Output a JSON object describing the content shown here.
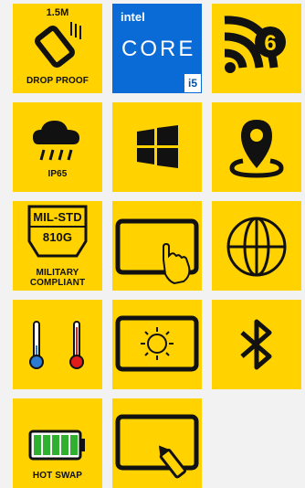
{
  "features": {
    "drop": {
      "height": "1.5M",
      "label": "DROP PROOF"
    },
    "cpu": {
      "brand": "intel",
      "line": "CORE",
      "tier": "i5"
    },
    "wifi": {
      "gen": "6"
    },
    "weather": {
      "label": "IP65"
    },
    "milstd": {
      "line1": "MIL-STD",
      "line2": "810G",
      "label_line1": "MILITARY",
      "label_line2": "COMPLIANT"
    },
    "battery": {
      "label": "HOT SWAP"
    }
  }
}
